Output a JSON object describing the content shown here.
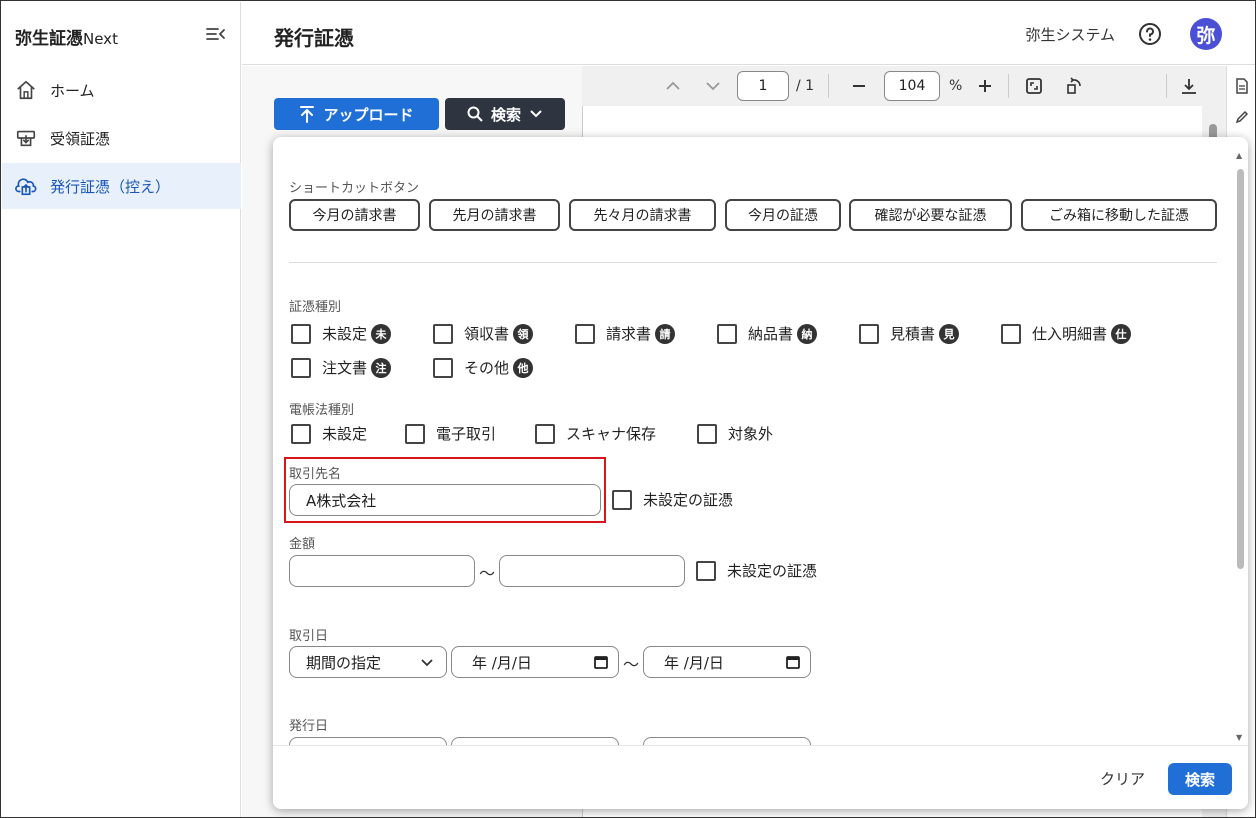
{
  "app": {
    "brand": "弥生証憑",
    "brand_suffix": "Next",
    "company": "弥生システム",
    "avatar_initial": "弥"
  },
  "sidebar": {
    "items": [
      {
        "label": "ホーム",
        "icon": "home-icon",
        "active": false
      },
      {
        "label": "受領証憑",
        "icon": "inbox-icon",
        "active": false
      },
      {
        "label": "発行証憑（控え）",
        "icon": "upload-cloud-icon",
        "active": true
      }
    ]
  },
  "header": {
    "title": "発行証憑"
  },
  "toolbar": {
    "upload_label": "アップロード",
    "search_label": "検索"
  },
  "pdf_viewer": {
    "page": "1",
    "total_pages": "/ 1",
    "zoom": "104",
    "zoom_unit": "%"
  },
  "search_dialog": {
    "shortcut_label": "ショートカットボタン",
    "shortcuts": [
      "今月の請求書",
      "先月の請求書",
      "先々月の請求書",
      "今月の証憑",
      "確認が必要な証憑",
      "ごみ箱に移動した証憑"
    ],
    "doc_type_label": "証憑種別",
    "doc_types": [
      {
        "label": "未設定",
        "badge": "未"
      },
      {
        "label": "領収書",
        "badge": "領"
      },
      {
        "label": "請求書",
        "badge": "請"
      },
      {
        "label": "納品書",
        "badge": "納"
      },
      {
        "label": "見積書",
        "badge": "見"
      },
      {
        "label": "仕入明細書",
        "badge": "仕"
      },
      {
        "label": "注文書",
        "badge": "注"
      },
      {
        "label": "その他",
        "badge": "他"
      }
    ],
    "ledger_label": "電帳法種別",
    "ledger_types": [
      "未設定",
      "電子取引",
      "スキャナ保存",
      "対象外"
    ],
    "partner_label": "取引先名",
    "partner_value": "A株式会社",
    "unset_label": "未設定の証憑",
    "amount_label": "金額",
    "amount_sep": "～",
    "trade_date_label": "取引日",
    "period_select": "期間の指定",
    "date_placeholder": "年 /月/日",
    "date_sep": "～",
    "issue_date_label": "発行日",
    "clear_label": "クリア",
    "search_label": "検索"
  },
  "colors": {
    "primary": "#1f6fd6",
    "dark_button": "#2e3540",
    "avatar": "#4b4fd6",
    "highlight": "#d9141a",
    "active_bg": "#e8f1fb"
  }
}
